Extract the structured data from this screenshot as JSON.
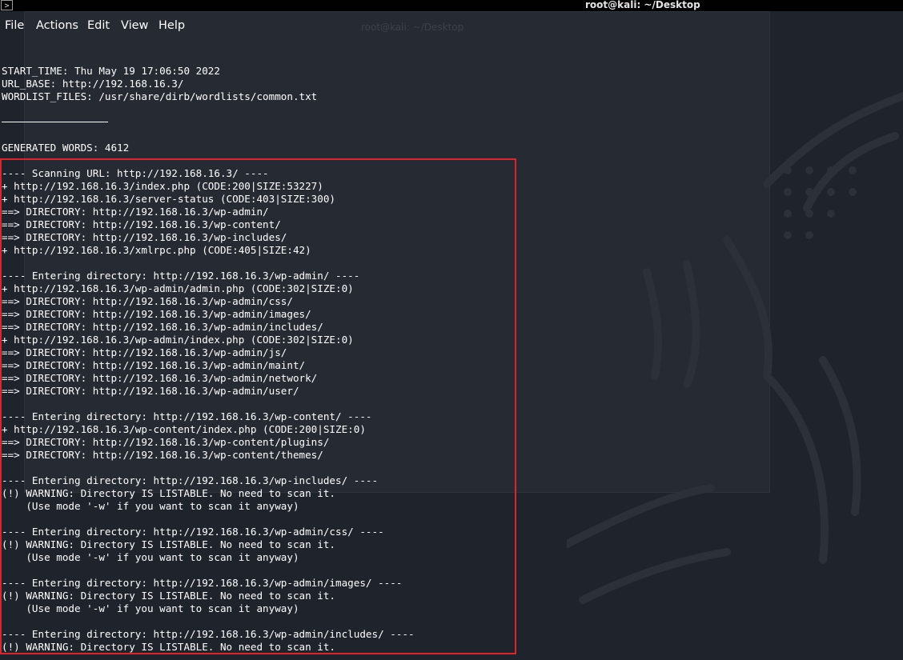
{
  "window": {
    "title": "root@kali: ~/Desktop"
  },
  "menu": [
    "File",
    "Actions",
    "Edit",
    "View",
    "Help"
  ],
  "terminal": {
    "header_lines": [
      "START_TIME: Thu May 19 17:06:50 2022",
      "URL_BASE: http://192.168.16.3/",
      "WORDLIST_FILES: /usr/share/dirb/wordlists/common.txt",
      "",
      "",
      "",
      "GENERATED WORDS: 4612",
      ""
    ],
    "output_lines": [
      "---- Scanning URL: http://192.168.16.3/ ----",
      "+ http://192.168.16.3/index.php (CODE:200|SIZE:53227)",
      "+ http://192.168.16.3/server-status (CODE:403|SIZE:300)",
      "==> DIRECTORY: http://192.168.16.3/wp-admin/",
      "==> DIRECTORY: http://192.168.16.3/wp-content/",
      "==> DIRECTORY: http://192.168.16.3/wp-includes/",
      "+ http://192.168.16.3/xmlrpc.php (CODE:405|SIZE:42)",
      "",
      "---- Entering directory: http://192.168.16.3/wp-admin/ ----",
      "+ http://192.168.16.3/wp-admin/admin.php (CODE:302|SIZE:0)",
      "==> DIRECTORY: http://192.168.16.3/wp-admin/css/",
      "==> DIRECTORY: http://192.168.16.3/wp-admin/images/",
      "==> DIRECTORY: http://192.168.16.3/wp-admin/includes/",
      "+ http://192.168.16.3/wp-admin/index.php (CODE:302|SIZE:0)",
      "==> DIRECTORY: http://192.168.16.3/wp-admin/js/",
      "==> DIRECTORY: http://192.168.16.3/wp-admin/maint/",
      "==> DIRECTORY: http://192.168.16.3/wp-admin/network/",
      "==> DIRECTORY: http://192.168.16.3/wp-admin/user/",
      "",
      "---- Entering directory: http://192.168.16.3/wp-content/ ----",
      "+ http://192.168.16.3/wp-content/index.php (CODE:200|SIZE:0)",
      "==> DIRECTORY: http://192.168.16.3/wp-content/plugins/",
      "==> DIRECTORY: http://192.168.16.3/wp-content/themes/",
      "",
      "---- Entering directory: http://192.168.16.3/wp-includes/ ----",
      "(!) WARNING: Directory IS LISTABLE. No need to scan it.",
      "    (Use mode '-w' if you want to scan it anyway)",
      "",
      "---- Entering directory: http://192.168.16.3/wp-admin/css/ ----",
      "(!) WARNING: Directory IS LISTABLE. No need to scan it.",
      "    (Use mode '-w' if you want to scan it anyway)",
      "",
      "---- Entering directory: http://192.168.16.3/wp-admin/images/ ----",
      "(!) WARNING: Directory IS LISTABLE. No need to scan it.",
      "    (Use mode '-w' if you want to scan it anyway)",
      "",
      "---- Entering directory: http://192.168.16.3/wp-admin/includes/ ----",
      "(!) WARNING: Directory IS LISTABLE. No need to scan it."
    ]
  },
  "colors": {
    "background": "#1f232b",
    "text": "#ffffff",
    "highlight_border": "#e0242c",
    "topbar": "#000000"
  },
  "icons": {
    "app": "terminal-icon"
  }
}
